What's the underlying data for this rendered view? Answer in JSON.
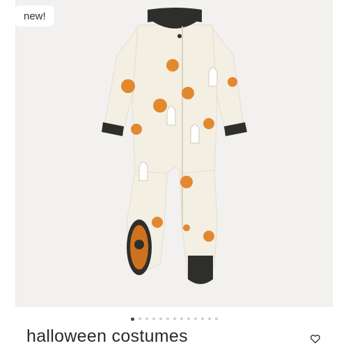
{
  "badge": {
    "label": "new!"
  },
  "product": {
    "title": "halloween costumes",
    "colors": {
      "fabric": "#f4efe3",
      "trim": "#2e2f2c",
      "pumpkin": "#e2892f",
      "sole_pad": "#e07a1e"
    }
  },
  "carousel": {
    "total": 13,
    "active": 1
  },
  "icons": {
    "wishlist": "heart-outline-icon"
  }
}
